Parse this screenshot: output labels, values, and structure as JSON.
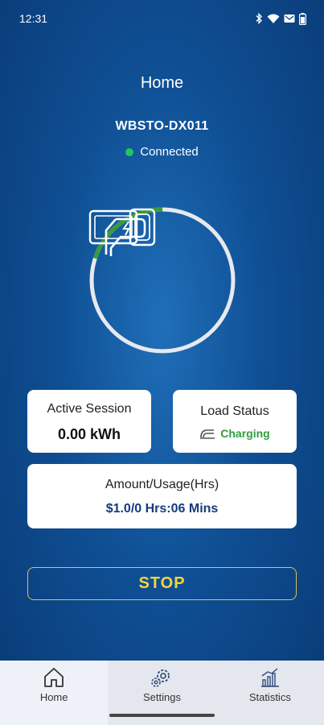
{
  "status_bar": {
    "time": "12:31",
    "icons": [
      "bluetooth-icon",
      "wifi-icon",
      "notification-icon",
      "battery-icon"
    ]
  },
  "header": {
    "title": "Home"
  },
  "device": {
    "name": "WBSTO-DX011",
    "connection_status": "Connected",
    "connection_color": "#22c55e"
  },
  "gauge": {
    "progress_fraction": 0.2,
    "progress_color": "#3a9a3a",
    "track_color": "#e6e9ee",
    "icon": "ev-charger-plug-icon"
  },
  "cards": {
    "active_session": {
      "title": "Active Session",
      "value": "0.00 kWh"
    },
    "load_status": {
      "title": "Load Status",
      "value": "Charging",
      "icon": "charging-plug-icon",
      "value_color": "#2e9e3e"
    },
    "amount_usage": {
      "title": "Amount/Usage(Hrs)",
      "value": "$1.0/0 Hrs:06 Mins"
    }
  },
  "actions": {
    "stop_label": "STOP"
  },
  "bottom_nav": {
    "items": [
      {
        "label": "Home",
        "icon": "home-icon"
      },
      {
        "label": "Settings",
        "icon": "gear-icon"
      },
      {
        "label": "Statistics",
        "icon": "bar-chart-icon"
      }
    ]
  }
}
